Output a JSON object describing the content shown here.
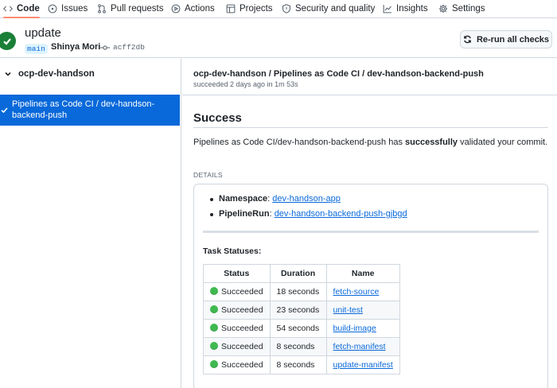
{
  "nav": {
    "tabs": [
      {
        "label": "Code",
        "icon": "code-icon",
        "active": true
      },
      {
        "label": "Issues",
        "icon": "issue-opened-icon"
      },
      {
        "label": "Pull requests",
        "icon": "git-pull-request-icon"
      },
      {
        "label": "Actions",
        "icon": "play-icon"
      },
      {
        "label": "Projects",
        "icon": "table-icon"
      },
      {
        "label": "Security and quality",
        "icon": "shield-icon"
      },
      {
        "label": "Insights",
        "icon": "graph-icon"
      },
      {
        "label": "Settings",
        "icon": "gear-icon"
      }
    ]
  },
  "header": {
    "commit_title": "update",
    "branch": "main",
    "author": "Shinya Mori",
    "sha": "acff2db",
    "rerun_label": "Re-run all checks",
    "status_color": "#1a7f37"
  },
  "sidebar": {
    "suite_name": "ocp-dev-handson",
    "selected_run": "Pipelines as Code CI / dev-handson-backend-push"
  },
  "main": {
    "run_path": "ocp-dev-handson / Pipelines as Code CI / dev-handson-backend-push",
    "run_meta": "succeeded 2 days ago in 1m 53s",
    "result_title": "Success",
    "summary_prefix": "Pipelines as Code CI/dev-handson-backend-push has ",
    "summary_bold": "successfully",
    "summary_suffix": " validated your commit.",
    "details_label": "DETAILS",
    "namespace_label": "Namespace",
    "namespace_value": "dev-handson-app",
    "pipelinerun_label": "PipelineRun",
    "pipelinerun_value": "dev-handson-backend-push-gjbgd",
    "task_statuses_title": "Task Statuses:",
    "table": {
      "headers": [
        "Status",
        "Duration",
        "Name"
      ],
      "rows": [
        {
          "status": "Succeeded",
          "duration": "18 seconds",
          "name": "fetch-source"
        },
        {
          "status": "Succeeded",
          "duration": "23 seconds",
          "name": "unit-test"
        },
        {
          "status": "Succeeded",
          "duration": "54 seconds",
          "name": "build-image"
        },
        {
          "status": "Succeeded",
          "duration": "8 seconds",
          "name": "fetch-manifest"
        },
        {
          "status": "Succeeded",
          "duration": "8 seconds",
          "name": "update-manifest"
        }
      ]
    },
    "success_dot_color": "#3fb950",
    "accent_color": "#0969da"
  }
}
